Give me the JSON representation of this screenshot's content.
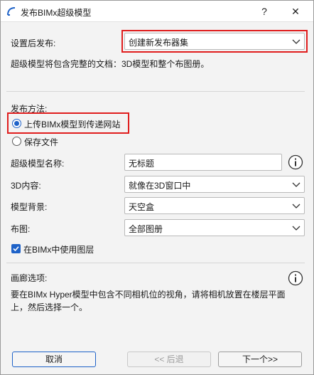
{
  "window": {
    "title": "发布BIMx超级模型",
    "help_glyph": "?",
    "close_glyph": "✕"
  },
  "publish_after": {
    "label": "设置后发布:",
    "value": "创建新发布器集"
  },
  "hyper_note": "超级模型将包含完整的文档：3D模型和整个布图册。",
  "publish_method": {
    "label": "发布方法:",
    "options": [
      "上传BIMx模型到传递网站",
      "保存文件"
    ],
    "selected_index": 0
  },
  "hyper_model_name": {
    "label": "超级模型名称:",
    "value": "无标题"
  },
  "content_3d": {
    "label": "3D内容:",
    "value": "就像在3D窗口中"
  },
  "model_background": {
    "label": "模型背景:",
    "value": "天空盒"
  },
  "layout": {
    "label": "布图:",
    "value": "全部图册"
  },
  "use_layers": {
    "label": "在BIMx中使用图层",
    "checked": true
  },
  "gallery": {
    "label": "画廊选项:",
    "description": "要在BIMx Hyper模型中包含不同相机位的视角，请将相机放置在楼层平面上，然后选择一个。"
  },
  "buttons": {
    "cancel": "取消",
    "back": "<< 后退",
    "next": "下一个>>"
  },
  "icons": {
    "app": "archicad-arc-icon",
    "info": "info-icon",
    "chevron": "chevron-down-icon",
    "check": "checkmark-icon"
  },
  "colors": {
    "accent": "#1e62c8",
    "highlight": "#e01d1d"
  }
}
